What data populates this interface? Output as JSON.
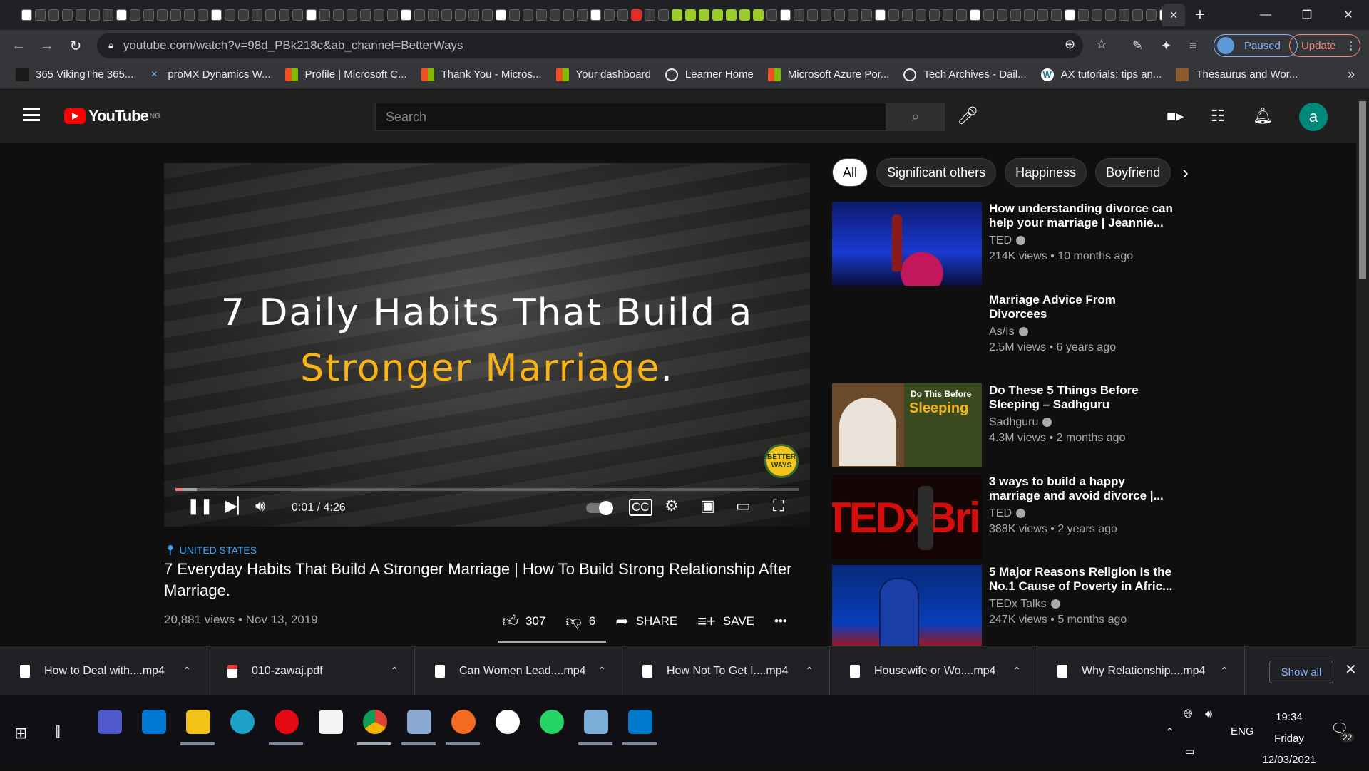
{
  "browser": {
    "active_tab_close": "×",
    "new_tab": "+",
    "url": "youtube.com/watch?v=98d_PBk218c&ab_channel=BetterWays",
    "profile_label": "Paused",
    "update_label": "Update"
  },
  "bookmarks": [
    {
      "label": "365 VikingThe 365..."
    },
    {
      "label": "proMX Dynamics W..."
    },
    {
      "label": "Profile | Microsoft C..."
    },
    {
      "label": "Thank You - Micros..."
    },
    {
      "label": "Your dashboard"
    },
    {
      "label": "Learner Home"
    },
    {
      "label": "Microsoft Azure Por..."
    },
    {
      "label": "Tech Archives - Dail..."
    },
    {
      "label": "AX tutorials: tips an..."
    },
    {
      "label": "Thesaurus and Wor..."
    }
  ],
  "youtube": {
    "logo_text": "YouTube",
    "region": "NG",
    "search_placeholder": "Search"
  },
  "player": {
    "overlay_line1": "7 Daily Habits That Build a",
    "overlay_line2": "Stronger Marriage",
    "overlay_period": ".",
    "watermark": "BETTER WAYS",
    "time_current": "0:01",
    "time_total": "4:26",
    "progress_fraction": 0.004
  },
  "video": {
    "location": "UNITED STATES",
    "title": "7 Everyday Habits That Build A Stronger Marriage | How To Build Strong Relationship After Marriage.",
    "views_date": "20,881 views • Nov 13, 2019",
    "likes": "307",
    "dislikes": "6",
    "share_label": "SHARE",
    "save_label": "SAVE"
  },
  "chips": [
    "All",
    "Significant others",
    "Happiness",
    "Boyfriend"
  ],
  "recommendations": [
    {
      "title": "How understanding divorce can help your marriage | Jeannie...",
      "channel": "TED",
      "stats": "214K views • 10 months ago"
    },
    {
      "title": "Marriage Advice From Divorcees",
      "channel": "As/Is",
      "stats": "2.5M views • 6 years ago"
    },
    {
      "title": "Do These 5 Things Before Sleeping – Sadhguru",
      "channel": "Sadhguru",
      "stats": "4.3M views • 2 months ago",
      "thumb_text1": "Do This Before",
      "thumb_text2": "Sleeping"
    },
    {
      "title": "3 ways to build a happy marriage and avoid divorce |...",
      "channel": "TED",
      "stats": "388K views • 2 years ago",
      "thumb_text": "TEDxBri"
    },
    {
      "title": "5 Major Reasons Religion Is the No.1 Cause of Poverty in Afric...",
      "channel": "TEDx Talks",
      "stats": "247K views • 5 months ago"
    }
  ],
  "downloads": [
    {
      "name": "How to Deal with....mp4"
    },
    {
      "name": "010-zawaj.pdf"
    },
    {
      "name": "Can Women Lead....mp4"
    },
    {
      "name": "How Not To Get I....mp4"
    },
    {
      "name": "Housewife or Wo....mp4"
    },
    {
      "name": "Why Relationship....mp4"
    }
  ],
  "downloads_show_all": "Show all",
  "taskbar": {
    "time": "19:34",
    "day": "Friday",
    "date": "12/03/2021",
    "language": "ENG",
    "notifications": "22"
  },
  "colors": {
    "yt_red": "#ff0000",
    "link_blue": "#3ea6ff",
    "overlay_yellow": "#f7b318",
    "avatar_teal": "#00897b"
  }
}
